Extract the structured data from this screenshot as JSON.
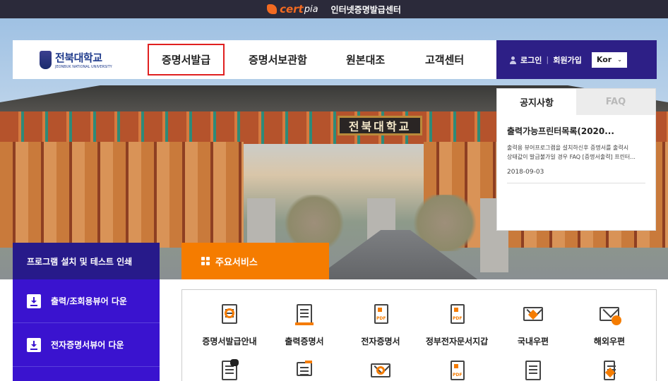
{
  "topbar": {
    "brand_cert": "cert",
    "brand_pia": "pia",
    "site_title": "인터넷증명발급센터"
  },
  "hero": {
    "gate_sign": "전북대학교"
  },
  "university": {
    "name": "전북대학교",
    "english_name": "JEONBUK NATIONAL UNIVERSITY"
  },
  "nav": {
    "items": [
      {
        "label": "증명서발급",
        "active": true
      },
      {
        "label": "증명서보관함",
        "active": false
      },
      {
        "label": "원본대조",
        "active": false
      },
      {
        "label": "고객센터",
        "active": false
      }
    ]
  },
  "userbar": {
    "login": "로그인",
    "separator": "|",
    "signup": "회원가입",
    "language": "Kor"
  },
  "notice": {
    "tabs": [
      "공지사항",
      "FAQ"
    ],
    "title": "출력가능프린터목록(2020...",
    "text_line1": "출력용 뷰어프로그램을 설치하신후 증명서를 출력시",
    "text_line2": "상태값이 발급불가일 경우 FAQ [증명서출력] 프린터...",
    "date": "2018-09-03"
  },
  "sidebar": {
    "heading": "프로그램 설치 및 테스트 인쇄",
    "items": [
      {
        "label": "출력/조회용뷰어 다운"
      },
      {
        "label": "전자증명서뷰어 다운"
      }
    ]
  },
  "services": {
    "tab_label": "주요서비스",
    "items": [
      {
        "label": "증명서발급안내",
        "icon": "document-search-icon"
      },
      {
        "label": "출력증명서",
        "icon": "printed-document-icon"
      },
      {
        "label": "전자증명서",
        "icon": "pdf-document-icon"
      },
      {
        "label": "정부전자문서지갑",
        "icon": "pdf-wallet-icon"
      },
      {
        "label": "국내우편",
        "icon": "domestic-mail-icon"
      },
      {
        "label": "해외우편",
        "icon": "overseas-mail-icon"
      }
    ],
    "row2_icons": [
      "talk-document-icon",
      "printer-icon",
      "email-icon",
      "qr-document-icon",
      "checklist-icon",
      "phone-icon"
    ]
  },
  "colors": {
    "primary_purple": "#2d1f86",
    "sidebar_purple": "#3a13cf",
    "accent_orange": "#f57c00",
    "active_outline_red": "#e02020"
  }
}
